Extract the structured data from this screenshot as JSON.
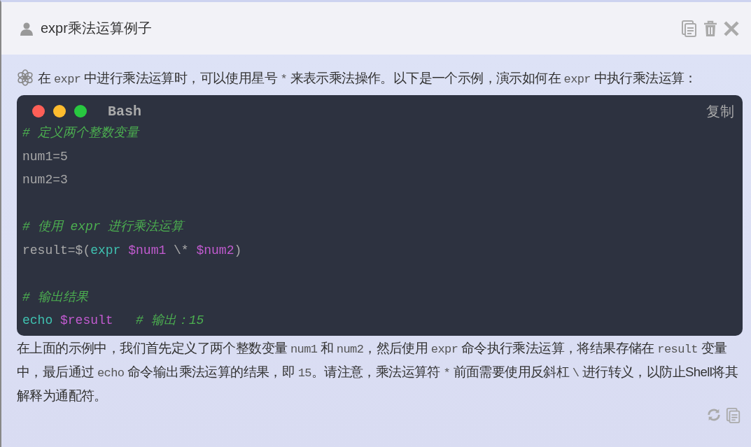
{
  "header": {
    "title": "expr乘法运算例子"
  },
  "intro": [
    {
      "kind": "text",
      "text": "在 "
    },
    {
      "kind": "code",
      "text": "expr"
    },
    {
      "kind": "text",
      "text": " 中进行乘法运算时，可以使用星号 "
    },
    {
      "kind": "code",
      "text": "*"
    },
    {
      "kind": "text",
      "text": " 来表示乘法操作。以下是一个示例，演示如何在 "
    },
    {
      "kind": "code",
      "text": "expr"
    },
    {
      "kind": "text",
      "text": " 中执行乘法运算："
    }
  ],
  "code_block": {
    "language": "Bash",
    "copy_label": "复制",
    "lines": [
      {
        "kind": "code",
        "tokens": [
          {
            "kind": "comment",
            "text": "# 定义两个整数变量"
          }
        ]
      },
      {
        "kind": "code",
        "tokens": [
          {
            "kind": "plain",
            "text": "num1=5"
          }
        ]
      },
      {
        "kind": "code",
        "tokens": [
          {
            "kind": "plain",
            "text": "num2=3"
          }
        ]
      },
      {
        "kind": "blank"
      },
      {
        "kind": "code",
        "tokens": [
          {
            "kind": "comment",
            "text": "# 使用 expr 进行乘法运算"
          }
        ]
      },
      {
        "kind": "code",
        "tokens": [
          {
            "kind": "plain",
            "text": "result=$("
          },
          {
            "kind": "command",
            "text": "expr"
          },
          {
            "kind": "variable",
            "text": " $num1"
          },
          {
            "kind": "plain",
            "text": " \\* "
          },
          {
            "kind": "variable",
            "text": "$num2"
          },
          {
            "kind": "plain",
            "text": ")"
          }
        ]
      },
      {
        "kind": "blank"
      },
      {
        "kind": "code",
        "tokens": [
          {
            "kind": "comment",
            "text": "# 输出结果"
          }
        ]
      },
      {
        "kind": "code",
        "tokens": [
          {
            "kind": "command",
            "text": "echo"
          },
          {
            "kind": "variable",
            "text": " $result"
          },
          {
            "kind": "comment",
            "text": "   # 输出：15"
          }
        ]
      }
    ]
  },
  "explanation": [
    {
      "kind": "text",
      "text": "在上面的示例中，我们首先定义了两个整数变量 "
    },
    {
      "kind": "code",
      "text": "num1"
    },
    {
      "kind": "text",
      "text": " 和 "
    },
    {
      "kind": "code",
      "text": "num2"
    },
    {
      "kind": "text",
      "text": "，然后使用 "
    },
    {
      "kind": "code",
      "text": "expr"
    },
    {
      "kind": "text",
      "text": " 命令执行乘法运算，将结果存储在 "
    },
    {
      "kind": "code",
      "text": "result"
    },
    {
      "kind": "text",
      "text": " 变量中，最后通过 "
    },
    {
      "kind": "code",
      "text": "echo"
    },
    {
      "kind": "text",
      "text": " 命令输出乘法运算的结果，即 "
    },
    {
      "kind": "code",
      "text": "15"
    },
    {
      "kind": "text",
      "text": "。请注意，乘法运算符 "
    },
    {
      "kind": "code",
      "text": "*"
    },
    {
      "kind": "text",
      "text": " 前面需要使用反斜杠 "
    },
    {
      "kind": "code",
      "text": "\\"
    },
    {
      "kind": "text",
      "text": " 进行转义，以防止Shell将其解释为通配符。"
    }
  ]
}
